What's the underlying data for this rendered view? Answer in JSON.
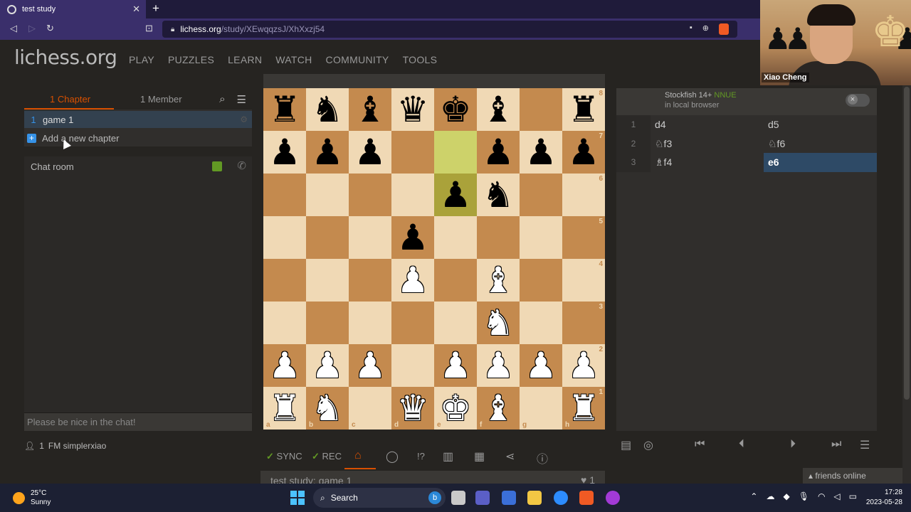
{
  "browser": {
    "tab_title": "test study",
    "url_domain": "lichess.org",
    "url_path": "/study/XEwqqzsJ/XhXxzj54"
  },
  "header": {
    "logo": "lichess.org",
    "nav": [
      "PLAY",
      "PUZZLES",
      "LEARN",
      "WATCH",
      "COMMUNITY",
      "TOOLS"
    ]
  },
  "study": {
    "tab_chapters": "1 Chapter",
    "tab_members": "1 Member",
    "chapter_number": "1",
    "chapter_name": "game 1",
    "add_chapter": "Add a new chapter",
    "chat_title": "Chat room",
    "chat_placeholder": "Please be nice in the chat!",
    "member_count": "1",
    "member_name": "FM simplerxiao",
    "title": "test study: game 1",
    "likes": "1"
  },
  "board": {
    "highlight": [
      "e7",
      "e6"
    ],
    "pieces": {
      "a8": "bR",
      "b8": "bN",
      "c8": "bB",
      "d8": "bQ",
      "e8": "bK",
      "f8": "bB",
      "h8": "bR",
      "a7": "bP",
      "b7": "bP",
      "c7": "bP",
      "f7": "bP",
      "g7": "bP",
      "h7": "bP",
      "e6": "bP",
      "f6": "bN",
      "d5": "bP",
      "d4": "wP",
      "f4": "wB",
      "f3": "wN",
      "a2": "wP",
      "b2": "wP",
      "c2": "wP",
      "e2": "wP",
      "f2": "wP",
      "g2": "wP",
      "h2": "wP",
      "a1": "wR",
      "b1": "wN",
      "d1": "wQ",
      "e1": "wK",
      "f1": "wB",
      "h1": "wR"
    }
  },
  "board_tools": {
    "sync": "SYNC",
    "rec": "REC",
    "glyph": "!?"
  },
  "analysis": {
    "engine": "Stockfish 14+",
    "nnue": "NNUE",
    "engine_sub": "in local browser",
    "moves": [
      {
        "n": "1",
        "w": "d4",
        "b": "d5"
      },
      {
        "n": "2",
        "w": "♘f3",
        "b": "♘f6"
      },
      {
        "n": "3",
        "w": "♗f4",
        "b": "e6"
      }
    ],
    "active_move": "e6"
  },
  "webcam": {
    "name": "Xiao Cheng"
  },
  "friends": "friends online",
  "taskbar": {
    "temp": "25°C",
    "weather": "Sunny",
    "search": "Search",
    "time": "17:28",
    "date": "2023-05-28"
  }
}
